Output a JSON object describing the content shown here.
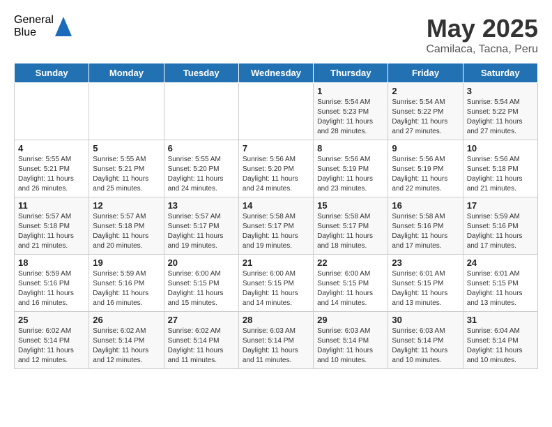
{
  "header": {
    "logo_general": "General",
    "logo_blue": "Blue",
    "title": "May 2025",
    "subtitle": "Camilaca, Tacna, Peru"
  },
  "calendar": {
    "days_of_week": [
      "Sunday",
      "Monday",
      "Tuesday",
      "Wednesday",
      "Thursday",
      "Friday",
      "Saturday"
    ],
    "weeks": [
      [
        {
          "day": "",
          "info": ""
        },
        {
          "day": "",
          "info": ""
        },
        {
          "day": "",
          "info": ""
        },
        {
          "day": "",
          "info": ""
        },
        {
          "day": "1",
          "info": "Sunrise: 5:54 AM\nSunset: 5:23 PM\nDaylight: 11 hours and 28 minutes."
        },
        {
          "day": "2",
          "info": "Sunrise: 5:54 AM\nSunset: 5:22 PM\nDaylight: 11 hours and 27 minutes."
        },
        {
          "day": "3",
          "info": "Sunrise: 5:54 AM\nSunset: 5:22 PM\nDaylight: 11 hours and 27 minutes."
        }
      ],
      [
        {
          "day": "4",
          "info": "Sunrise: 5:55 AM\nSunset: 5:21 PM\nDaylight: 11 hours and 26 minutes."
        },
        {
          "day": "5",
          "info": "Sunrise: 5:55 AM\nSunset: 5:21 PM\nDaylight: 11 hours and 25 minutes."
        },
        {
          "day": "6",
          "info": "Sunrise: 5:55 AM\nSunset: 5:20 PM\nDaylight: 11 hours and 24 minutes."
        },
        {
          "day": "7",
          "info": "Sunrise: 5:56 AM\nSunset: 5:20 PM\nDaylight: 11 hours and 24 minutes."
        },
        {
          "day": "8",
          "info": "Sunrise: 5:56 AM\nSunset: 5:19 PM\nDaylight: 11 hours and 23 minutes."
        },
        {
          "day": "9",
          "info": "Sunrise: 5:56 AM\nSunset: 5:19 PM\nDaylight: 11 hours and 22 minutes."
        },
        {
          "day": "10",
          "info": "Sunrise: 5:56 AM\nSunset: 5:18 PM\nDaylight: 11 hours and 21 minutes."
        }
      ],
      [
        {
          "day": "11",
          "info": "Sunrise: 5:57 AM\nSunset: 5:18 PM\nDaylight: 11 hours and 21 minutes."
        },
        {
          "day": "12",
          "info": "Sunrise: 5:57 AM\nSunset: 5:18 PM\nDaylight: 11 hours and 20 minutes."
        },
        {
          "day": "13",
          "info": "Sunrise: 5:57 AM\nSunset: 5:17 PM\nDaylight: 11 hours and 19 minutes."
        },
        {
          "day": "14",
          "info": "Sunrise: 5:58 AM\nSunset: 5:17 PM\nDaylight: 11 hours and 19 minutes."
        },
        {
          "day": "15",
          "info": "Sunrise: 5:58 AM\nSunset: 5:17 PM\nDaylight: 11 hours and 18 minutes."
        },
        {
          "day": "16",
          "info": "Sunrise: 5:58 AM\nSunset: 5:16 PM\nDaylight: 11 hours and 17 minutes."
        },
        {
          "day": "17",
          "info": "Sunrise: 5:59 AM\nSunset: 5:16 PM\nDaylight: 11 hours and 17 minutes."
        }
      ],
      [
        {
          "day": "18",
          "info": "Sunrise: 5:59 AM\nSunset: 5:16 PM\nDaylight: 11 hours and 16 minutes."
        },
        {
          "day": "19",
          "info": "Sunrise: 5:59 AM\nSunset: 5:16 PM\nDaylight: 11 hours and 16 minutes."
        },
        {
          "day": "20",
          "info": "Sunrise: 6:00 AM\nSunset: 5:15 PM\nDaylight: 11 hours and 15 minutes."
        },
        {
          "day": "21",
          "info": "Sunrise: 6:00 AM\nSunset: 5:15 PM\nDaylight: 11 hours and 14 minutes."
        },
        {
          "day": "22",
          "info": "Sunrise: 6:00 AM\nSunset: 5:15 PM\nDaylight: 11 hours and 14 minutes."
        },
        {
          "day": "23",
          "info": "Sunrise: 6:01 AM\nSunset: 5:15 PM\nDaylight: 11 hours and 13 minutes."
        },
        {
          "day": "24",
          "info": "Sunrise: 6:01 AM\nSunset: 5:15 PM\nDaylight: 11 hours and 13 minutes."
        }
      ],
      [
        {
          "day": "25",
          "info": "Sunrise: 6:02 AM\nSunset: 5:14 PM\nDaylight: 11 hours and 12 minutes."
        },
        {
          "day": "26",
          "info": "Sunrise: 6:02 AM\nSunset: 5:14 PM\nDaylight: 11 hours and 12 minutes."
        },
        {
          "day": "27",
          "info": "Sunrise: 6:02 AM\nSunset: 5:14 PM\nDaylight: 11 hours and 11 minutes."
        },
        {
          "day": "28",
          "info": "Sunrise: 6:03 AM\nSunset: 5:14 PM\nDaylight: 11 hours and 11 minutes."
        },
        {
          "day": "29",
          "info": "Sunrise: 6:03 AM\nSunset: 5:14 PM\nDaylight: 11 hours and 10 minutes."
        },
        {
          "day": "30",
          "info": "Sunrise: 6:03 AM\nSunset: 5:14 PM\nDaylight: 11 hours and 10 minutes."
        },
        {
          "day": "31",
          "info": "Sunrise: 6:04 AM\nSunset: 5:14 PM\nDaylight: 11 hours and 10 minutes."
        }
      ]
    ]
  }
}
